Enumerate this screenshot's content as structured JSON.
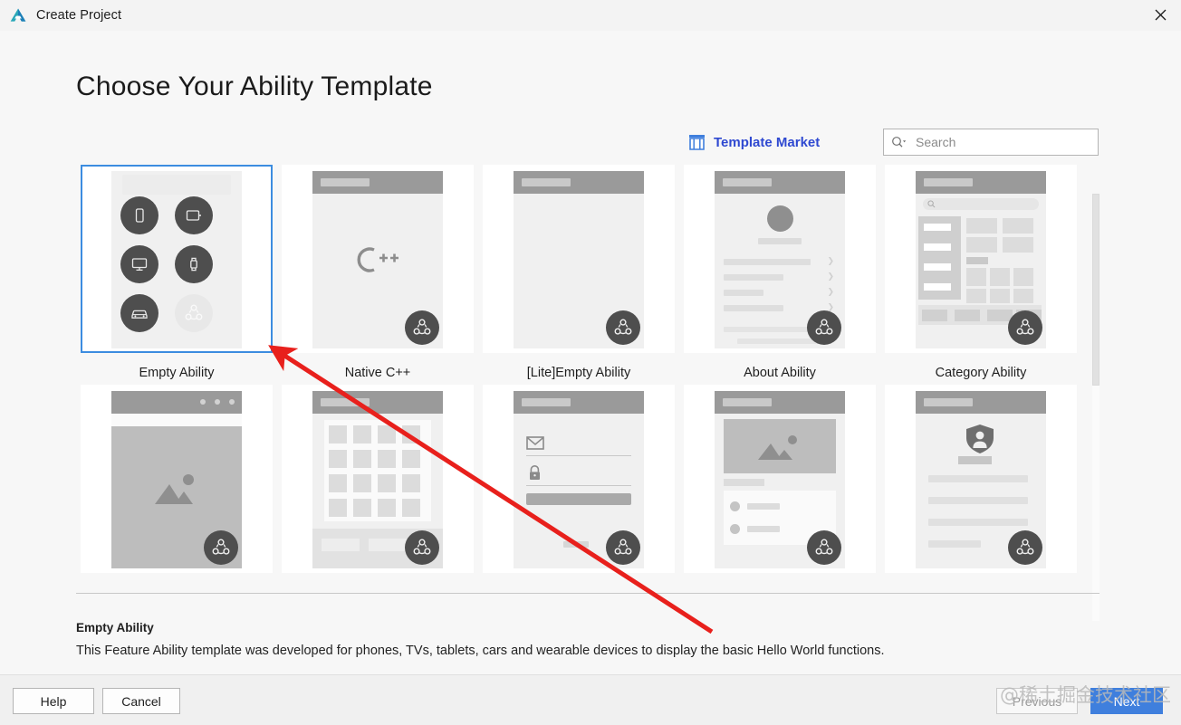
{
  "window": {
    "title": "Create Project",
    "logo_icon": "deveco-logo-icon",
    "close_icon": "close-icon"
  },
  "page": {
    "heading": "Choose Your Ability Template"
  },
  "toolbar": {
    "market_label": "Template Market",
    "market_icon": "store-icon",
    "search_placeholder": "Search",
    "search_value": "",
    "search_icon": "search-dropdown-icon"
  },
  "templates": [
    {
      "label": "Empty Ability",
      "selected": true,
      "mock": "devices"
    },
    {
      "label": "Native C++",
      "selected": false,
      "mock": "cpp",
      "logo_text": "C++"
    },
    {
      "label": "[Lite]Empty Ability",
      "selected": false,
      "mock": "blank"
    },
    {
      "label": "About Ability",
      "selected": false,
      "mock": "about"
    },
    {
      "label": "Category Ability",
      "selected": false,
      "mock": "category"
    },
    {
      "label": "",
      "selected": false,
      "mock": "image"
    },
    {
      "label": "",
      "selected": false,
      "mock": "grid"
    },
    {
      "label": "",
      "selected": false,
      "mock": "login"
    },
    {
      "label": "",
      "selected": false,
      "mock": "news"
    },
    {
      "label": "",
      "selected": false,
      "mock": "shield"
    }
  ],
  "description": {
    "title": "Empty Ability",
    "text": "This Feature Ability template was developed for phones, TVs, tablets, cars and wearable devices to display the basic Hello World functions."
  },
  "footer": {
    "help": "Help",
    "cancel": "Cancel",
    "previous": "Previous",
    "next": "Next"
  },
  "watermark": "@稀土掘金技术社区",
  "colors": {
    "accent": "#3f7fdd",
    "selection_border": "#3c8ce0",
    "market_link": "#2f49d1",
    "annotation_arrow": "#e8201c"
  }
}
